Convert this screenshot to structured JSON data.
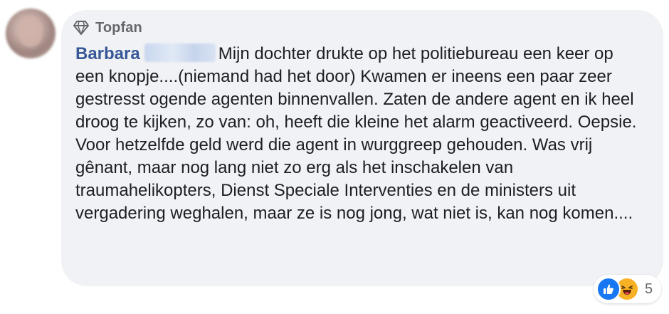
{
  "badge": {
    "icon": "diamond-icon",
    "label": "Topfan"
  },
  "comment": {
    "author": "Barbara",
    "text_line_1": "Mijn dochter drukte op het politiebureau een keer op een knopje....(niemand had het door) Kwamen er ineens een paar zeer gestresst ogende agenten binnenvallen. Zaten de andere agent en ik heel droog te kijken, zo van: oh, heeft die kleine het alarm geactiveerd. Oepsie.",
    "text_line_2": "Voor hetzelfde geld werd die agent in wurggreep gehouden. Was vrij gênant, maar nog lang niet zo erg als het inschakelen van traumahelikopters, Dienst Speciale Interventies en de ministers uit vergadering weghalen, maar ze is nog jong, wat niet is, kan nog komen...."
  },
  "reactions": {
    "icons": [
      "like-icon",
      "haha-icon"
    ],
    "count": "5"
  },
  "colors": {
    "bubble": "#f0f2f5",
    "author": "#385898",
    "like": "#1877f2",
    "haha": "#f7b125",
    "meta": "#65676b"
  }
}
